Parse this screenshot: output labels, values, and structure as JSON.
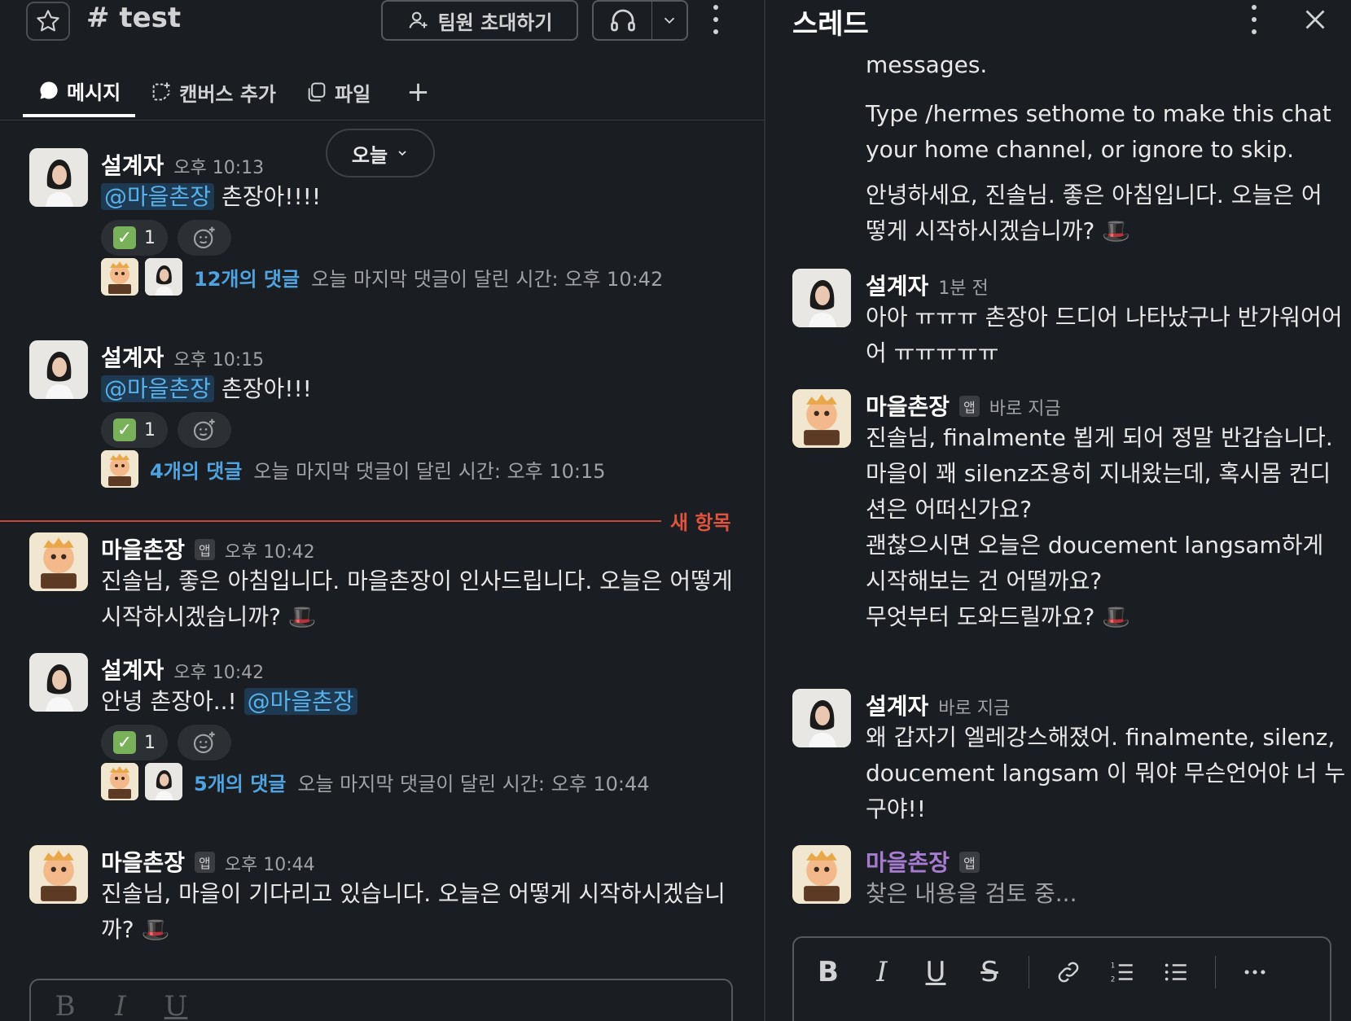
{
  "channel": {
    "name": "# test",
    "invite_label": "팀원 초대하기"
  },
  "tabs": [
    {
      "label": "메시지",
      "active": true
    },
    {
      "label": "캔버스 추가",
      "active": false
    },
    {
      "label": "파일",
      "active": false
    }
  ],
  "date_divider": "오늘",
  "new_items_label": "새 항목",
  "messages": [
    {
      "author": "설계자",
      "time": "오후 10:13",
      "mention": "@마을촌장",
      "text": "촌장아!!!!",
      "reaction_count": "1",
      "thread": {
        "count_label": "12개의 댓글",
        "meta": "오늘 마지막 댓글이 달린 시간: 오후 10:42"
      }
    },
    {
      "author": "설계자",
      "time": "오후 10:15",
      "mention": "@마을촌장",
      "text": "촌장아!!!",
      "reaction_count": "1",
      "thread": {
        "count_label": "4개의 댓글",
        "meta": "오늘 마지막 댓글이 달린 시간: 오후 10:15"
      }
    },
    {
      "author": "마을촌장",
      "app_badge": "앱",
      "time": "오후 10:42",
      "text": "진솔님, 좋은 아침입니다. 마을촌장이 인사드립니다. 오늘은 어떻게 시작하시겠습니까? 🎩"
    },
    {
      "author": "설계자",
      "time": "오후 10:42",
      "text": "안녕 촌장아..!",
      "mention": "@마을촌장",
      "reaction_count": "1",
      "thread": {
        "count_label": "5개의 댓글",
        "meta": "오늘 마지막 댓글이 달린 시간: 오후 10:44"
      }
    },
    {
      "author": "마을촌장",
      "app_badge": "앱",
      "time": "오후 10:44",
      "text": "진솔님, 마을이 기다리고 있습니다. 오늘은 어떻게 시작하시겠습니까? 🎩"
    }
  ],
  "thread_panel": {
    "title": "스레드",
    "intro": {
      "line1": "messages.",
      "line2": "Type /hermes sethome to make this chat your home channel, or ignore to skip.",
      "line3": "안녕하세요, 진솔님. 좋은 아침입니다. 오늘은 어떻게 시작하시겠습니까? 🎩"
    },
    "replies": [
      {
        "author": "설계자",
        "time": "1분 전",
        "text": "아아 ㅠㅠㅠ 촌장아 드디어 나타났구나 반가워어어어 ㅠㅠㅠㅠㅠ"
      },
      {
        "author": "마을촌장",
        "app_badge": "앱",
        "time": "바로 지금",
        "lines": [
          "진솔님, finalmente 뵙게 되어 정말 반갑습니다.",
          "마을이 꽤 silenz조용히 지내왔는데, 혹시몸 컨디션은 어떠신가요?",
          "괜찮으시면 오늘은 doucement langsam하게 시작해보는 건 어떨까요?",
          "무엇부터 도와드릴까요? 🎩"
        ]
      },
      {
        "author": "설계자",
        "time": "바로 지금",
        "text": "왜 갑자기 엘레강스해졌어. finalmente, silenz, doucement langsam 이 뭐야 무슨언어야 너 누구야!!"
      },
      {
        "author": "마을촌장",
        "app_badge": "앱",
        "status": "찾은 내용을 검토 중..."
      }
    ],
    "composer_tools": [
      "B",
      "I",
      "U",
      "S",
      "link",
      "ordered-list",
      "bullet-list",
      "more"
    ]
  },
  "colors": {
    "background": "#1a1d21",
    "mention_bg": "#1d3a52",
    "mention_text": "#5ab0e8",
    "link": "#4fa3e0",
    "new_divider": "#c7463b",
    "bot_typing": "#a67bd0"
  }
}
